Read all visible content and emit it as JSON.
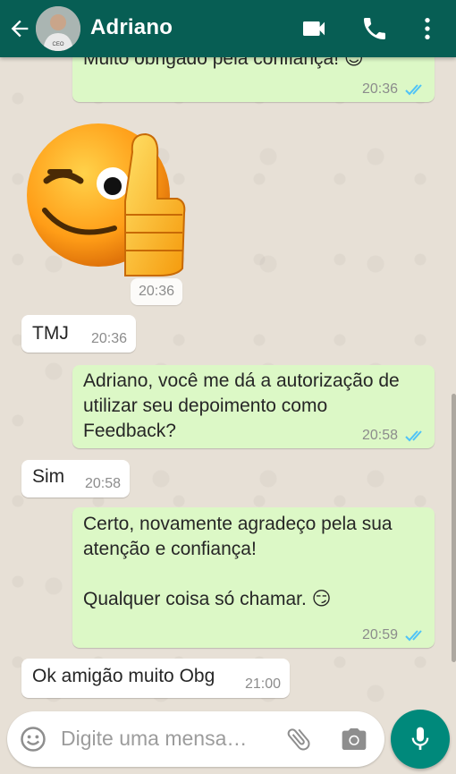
{
  "header": {
    "contact_name": "Adriano",
    "avatar_caption": "CEO"
  },
  "messages": [
    {
      "dir": "out",
      "text": "Muito obrigado pela confiança! 😉",
      "time": "20:36",
      "read": true
    },
    {
      "dir": "in",
      "type": "sticker",
      "sticker": "thumbs-up-wink-emoji",
      "time": "20:36"
    },
    {
      "dir": "in",
      "text": "TMJ",
      "time": "20:36"
    },
    {
      "dir": "out",
      "text": "Adriano, você me dá a autorização de utilizar seu depoimento como Feedback?",
      "time": "20:58",
      "read": true
    },
    {
      "dir": "in",
      "text": "Sim",
      "time": "20:58"
    },
    {
      "dir": "out",
      "text": "Certo, novamente agradeço pela sua atenção e confiança!\n\nQualquer coisa só chamar. 😏",
      "time": "20:59",
      "read": true
    },
    {
      "dir": "in",
      "text": "Ok amigão muito Obg",
      "time": "21:00"
    }
  ],
  "composer": {
    "placeholder": "Digite uma mensa…"
  },
  "colors": {
    "header": "#075e54",
    "outgoing_bubble": "#dcf8c6",
    "incoming_bubble": "#ffffff",
    "read_ticks": "#4fc3f7",
    "mic_button": "#00897b"
  }
}
